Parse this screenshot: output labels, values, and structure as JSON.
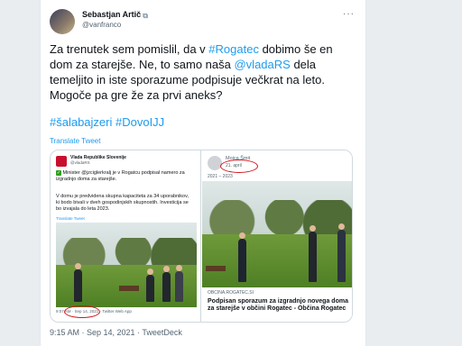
{
  "tweet": {
    "author_name": "Sebastjan Artič",
    "author_handle": "@vanfranco",
    "more_icon": "ellipsis-icon",
    "text_part1": "Za trenutek sem pomislil, da v ",
    "hashtag1": "#Rogatec",
    "text_part2": " dobimo še en dom za starejše. Ne, to samo naša ",
    "mention1": "@vladaRS",
    "text_part3": " dela temeljito in iste sporazume podpisuje večkrat na leto. Mogoče pa gre že za prvi aneks?",
    "hashtags_line": "#šalabajzeri #DovoIJJ",
    "translate_label": "Translate Tweet",
    "timestamp": "9:15 AM · Sep 14, 2021 · TweetDeck"
  },
  "embedded_left": {
    "author_name": "Vlada Republike Slovenije",
    "author_handle": "@vladaRS",
    "text1": "Minister @jzciglerkralj je v Rogatcu podpisal namero za izgradnjo doma za starejše.",
    "text2": "V domu je predvidena skupna kapaciteta za 34 uporabnikov, ki bodo bivali v dveh gospodinjskih skupnostih. Investicija se bo izvajala do leta 2023.",
    "translate_label": "Translate Tweet",
    "meta": "9:07 AM · Sep 14, 2021 · Twitter Web App"
  },
  "embedded_right": {
    "author_name": "Mojca Šmit",
    "date": "21. april",
    "years": "2021 – 2023",
    "domain": "OBCINA.ROGATEC.SI",
    "title": "Podpisan sporazum za izgradnjo novega doma za starejše v občini Rogatec - Občina Rogatec"
  },
  "colors": {
    "link": "#1d9bf0",
    "annotation_red": "#d0141a"
  }
}
